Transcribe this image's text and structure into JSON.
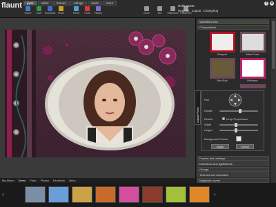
{
  "app": {
    "logo": "flaunt",
    "tabs": [
      "pynk",
      "editor",
      "frames",
      "collage",
      "cards",
      "more"
    ],
    "active_tab": 0
  },
  "toolbar": {
    "tools": [
      {
        "label": "import",
        "icon": "import-icon",
        "color": "#3b7fd1"
      },
      {
        "label": "Save",
        "icon": "save-icon",
        "color": "#2e9b3f"
      },
      {
        "label": "Download",
        "icon": "download-icon",
        "color": "#3f6fd0"
      },
      {
        "label": "Share",
        "icon": "share-icon",
        "color": "#c8a32f"
      },
      {
        "label": "Reset",
        "icon": "reset-icon",
        "color": "#4aa0d8"
      },
      {
        "label": "Undo",
        "icon": "undo-icon",
        "color": "#d43c3c"
      },
      {
        "label": "History",
        "icon": "history-icon",
        "color": "#7a6fd0"
      }
    ],
    "right_tools": [
      {
        "label": "Zoom",
        "icon": "zoom-icon"
      },
      {
        "label": "Info",
        "icon": "info-icon"
      },
      {
        "label": "Slideshow",
        "icon": "slideshow-icon"
      },
      {
        "label": "Fullscreen",
        "icon": "fullscreen-icon"
      }
    ]
  },
  "user": {
    "greeting": "Hello Guest",
    "links": [
      "Register",
      "Logout",
      "Changelog"
    ]
  },
  "panel": {
    "header": "Valentines Day",
    "section": "Compositions",
    "thumbs": [
      {
        "label": "Wrapped",
        "style": "frame-red"
      },
      {
        "label": "AlbumCover",
        "style": "frame-dark"
      },
      {
        "label": "Bits'n'Bob",
        "style": "frame-dark"
      },
      {
        "label": "Pinkdress",
        "style": "frame-pink"
      },
      {
        "label": "Doodles",
        "style": "frame-dark"
      }
    ],
    "sections": [
      "Frames and overlays",
      "Distortions and lightleffects",
      "Grunge",
      "Textures and Canvases",
      "Magazine covers"
    ]
  },
  "adjust": {
    "tab_label": "Adjust Photo",
    "rows": {
      "pan": "Pan",
      "rotate": "Rotate",
      "resize": "Resize",
      "keep_proportions": "Keep Proportions",
      "width": "Width",
      "height": "Height",
      "background_colour": "Background Colour"
    },
    "apply": "Apply",
    "cancel": "Cancel"
  },
  "strip": {
    "tabs": [
      "My Album",
      "Demo",
      "Flickr",
      "Picasa",
      "Facebook",
      "Bebo"
    ],
    "active": 1,
    "thumbs": [
      {
        "color": "#7a8ea6",
        "icon": "sky-photo"
      },
      {
        "color": "#6a9ed6",
        "icon": "beach-photo"
      },
      {
        "color": "#c9a24a",
        "icon": "sunset-photo"
      },
      {
        "color": "#c66b2a",
        "icon": "portrait-photo"
      },
      {
        "color": "#d44fa0",
        "icon": "flower-photo"
      },
      {
        "color": "#8b3b2b",
        "icon": "fireworks-photo"
      },
      {
        "color": "#a2c03a",
        "icon": "lime-photo"
      },
      {
        "color": "#e0862a",
        "icon": "orange-photo"
      }
    ]
  }
}
